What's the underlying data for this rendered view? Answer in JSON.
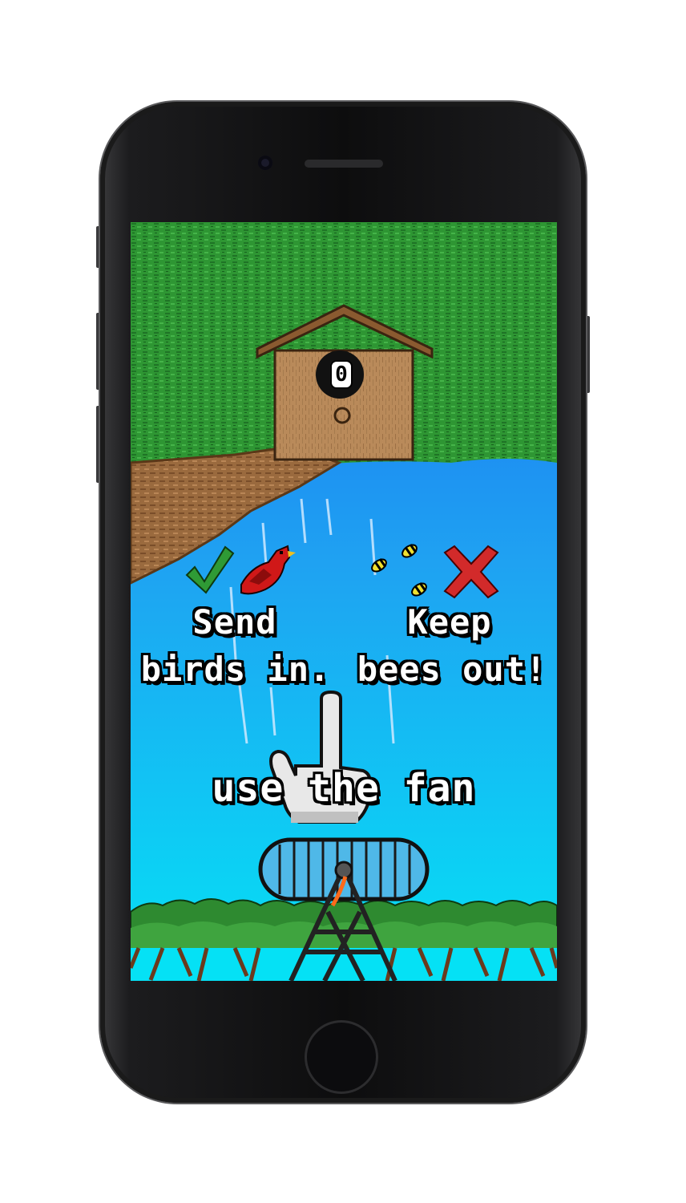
{
  "game": {
    "score": "0",
    "left_line1": "Send",
    "left_line2": "birds in.",
    "right_line1": "Keep",
    "right_line2": "bees out!",
    "instruction": "use the fan"
  },
  "icons": {
    "checkmark": "check-icon",
    "cross": "cross-icon",
    "bird": "red-bird-icon",
    "bee": "bee-icon",
    "hand": "pointing-hand-icon",
    "fan": "fan-icon",
    "birdhouse": "birdhouse-icon"
  },
  "colors": {
    "sky_top": "#1a6ef0",
    "sky_bottom": "#05e1f5",
    "foliage": "#2f9a35",
    "check": "#2f9a35",
    "cross": "#d22a2a",
    "bird": "#d01818",
    "bee": "#f0e030",
    "house": "#b98a5a"
  }
}
